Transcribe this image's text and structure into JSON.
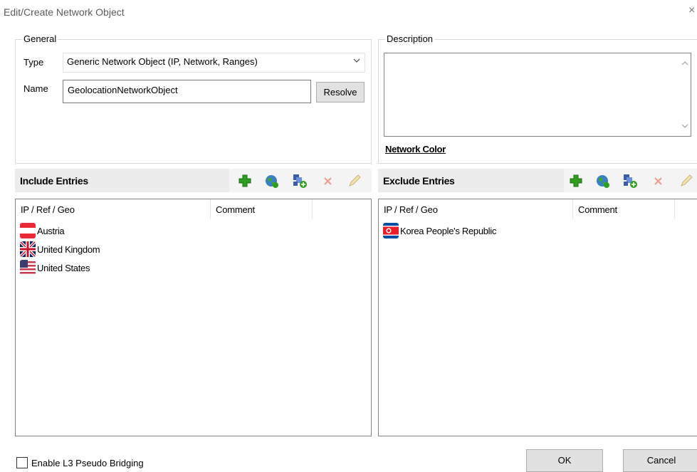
{
  "dialog": {
    "title": "Edit/Create Network Object",
    "close_glyph": "×"
  },
  "general": {
    "legend": "General",
    "type_label": "Type",
    "type_value": "Generic Network Object (IP, Network, Ranges)",
    "name_label": "Name",
    "name_value": "GeolocationNetworkObject",
    "resolve_label": "Resolve"
  },
  "description": {
    "legend": "Description",
    "value": "",
    "network_color_link": "Network Color"
  },
  "include": {
    "title": "Include Entries",
    "columns": [
      "IP / Ref / Geo",
      "Comment"
    ],
    "rows": [
      {
        "label": "Austria",
        "flag": "austria-flag-icon"
      },
      {
        "label": "United Kingdom",
        "flag": "uk-flag-icon"
      },
      {
        "label": "United States",
        "flag": "us-flag-icon"
      }
    ],
    "toolbar": [
      "add-icon",
      "globe-icon",
      "add-object-icon",
      "delete-icon",
      "edit-icon"
    ]
  },
  "exclude": {
    "title": "Exclude Entries",
    "columns": [
      "IP / Ref / Geo",
      "Comment"
    ],
    "rows": [
      {
        "label": "Korea People's Republic",
        "flag": "north-korea-flag-icon"
      }
    ],
    "toolbar": [
      "add-icon",
      "globe-icon",
      "add-object-icon",
      "delete-icon",
      "edit-icon"
    ]
  },
  "footer": {
    "checkbox_label": "Enable L3 Pseudo Bridging",
    "checkbox_checked": false,
    "ok_label": "OK",
    "cancel_label": "Cancel"
  },
  "colors": {
    "toolbar_bg": "#ececec",
    "add_green": "#2e9e1f",
    "delete_red": "#e0533a",
    "button_bg": "#e1e1e1"
  }
}
